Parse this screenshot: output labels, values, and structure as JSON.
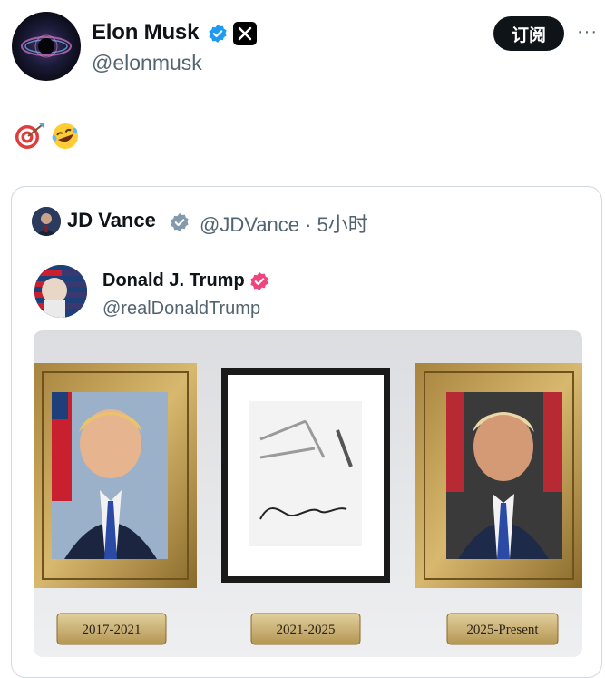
{
  "author": {
    "name": "Elon Musk",
    "handle": "@elonmusk"
  },
  "actions": {
    "subscribe_label": "订阅",
    "more_label": "···"
  },
  "post": {
    "emojis": [
      "direct-hit",
      "rolling-on-floor-laughing"
    ]
  },
  "quoted": {
    "name": "JD Vance",
    "handle_time": "@JDVance · 5小时",
    "inner": {
      "name": "Donald J. Trump",
      "handle": "@realDonaldTrump",
      "plaques": [
        "2017-2021",
        "2021-2025",
        "2025-Present"
      ]
    }
  },
  "colors": {
    "verified_blue": "#1d9bf0",
    "verified_gray": "#829aab",
    "verified_pink": "#f0447f",
    "subscribe_bg": "#0f1419"
  }
}
